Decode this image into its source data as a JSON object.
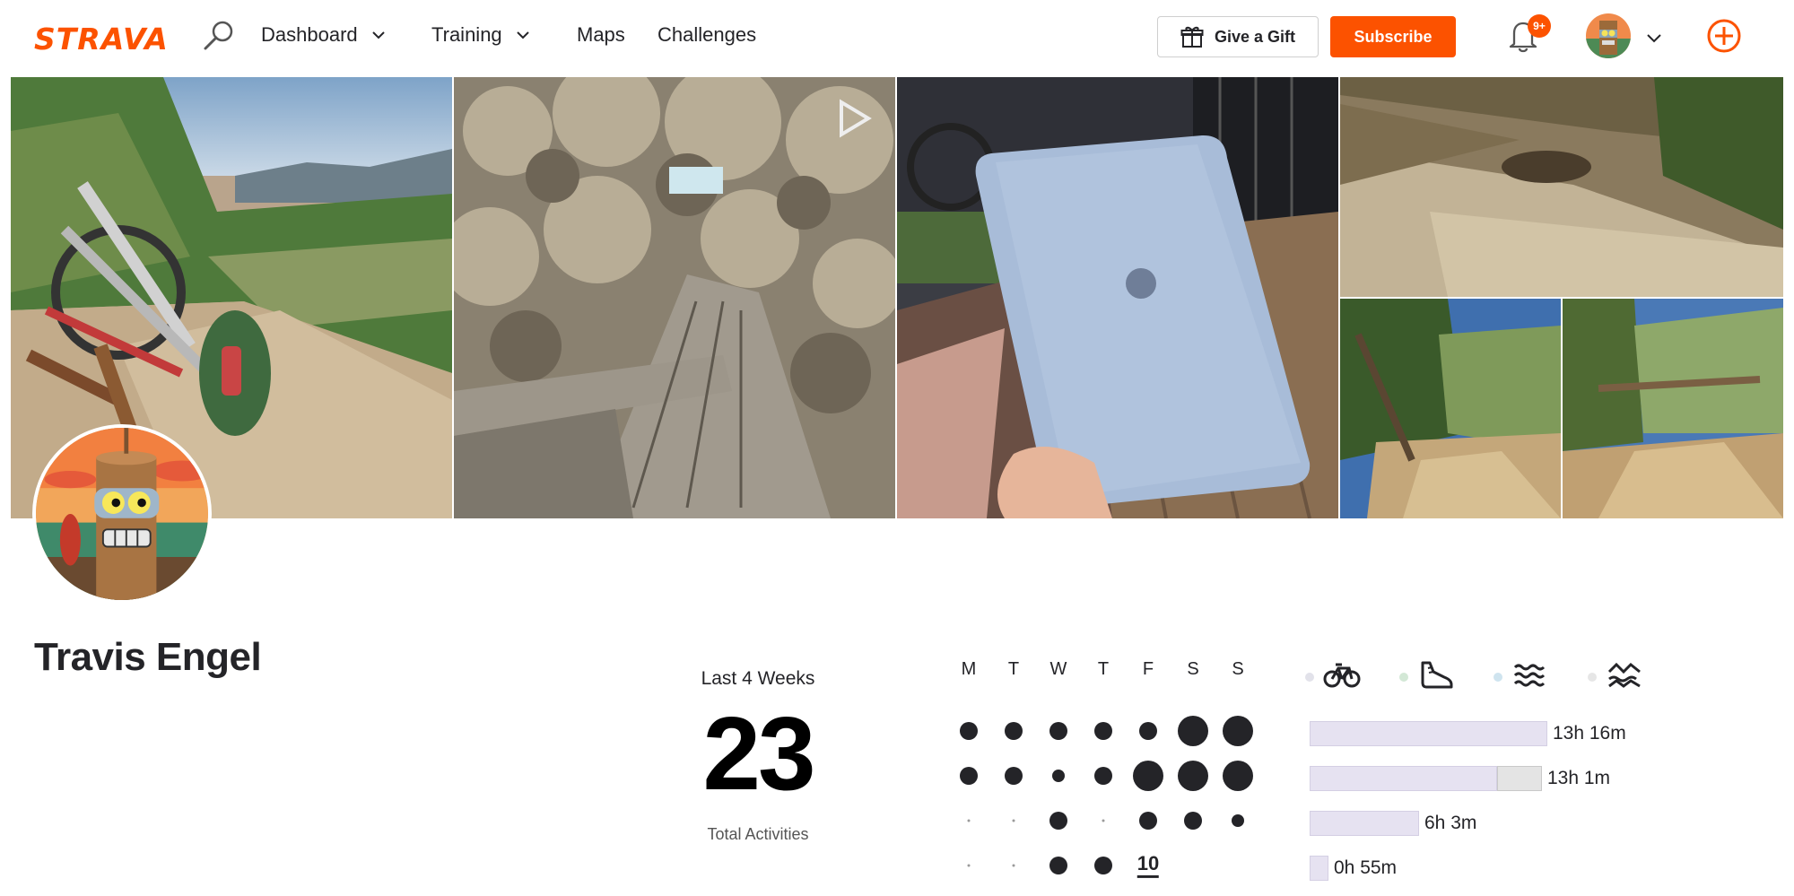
{
  "nav": {
    "logo": "STRAVA",
    "items": [
      {
        "label": "Dashboard",
        "has_dropdown": true
      },
      {
        "label": "Training",
        "has_dropdown": true
      },
      {
        "label": "Maps",
        "has_dropdown": false
      },
      {
        "label": "Challenges",
        "has_dropdown": false
      }
    ],
    "gift_label": "Give a Gift",
    "subscribe_label": "Subscribe",
    "notification_badge": "9+",
    "brand_color": "#fc5200"
  },
  "photos": [
    {
      "subject": "bike-on-trail"
    },
    {
      "subject": "fallen-tree-canopy"
    },
    {
      "subject": "laptop-on-porch"
    },
    {
      "subject": "trail-with-debris"
    },
    {
      "subject": "trail-fallen-trees-left"
    },
    {
      "subject": "trail-fallen-trees-right"
    }
  ],
  "athlete": {
    "name": "Travis Engel"
  },
  "stats": {
    "period_label": "Last 4 Weeks",
    "total": "23",
    "total_label": "Total Activities",
    "days": [
      "M",
      "T",
      "W",
      "T",
      "F",
      "S",
      "S"
    ],
    "today_label": "10",
    "weeks": [
      [
        2,
        2,
        2,
        2,
        2,
        3,
        3
      ],
      [
        2,
        2,
        1,
        2,
        3,
        3,
        3
      ],
      [
        0,
        0,
        2,
        0,
        2,
        2,
        1
      ],
      [
        0,
        0,
        2,
        2,
        "today",
        null,
        null
      ]
    ]
  },
  "sports": [
    {
      "icon": "bike-icon",
      "dot_color": "#e2e2ea"
    },
    {
      "icon": "run-shoe-icon",
      "dot_color": "#d3e8d6"
    },
    {
      "icon": "swim-icon",
      "dot_color": "#cfe4ef"
    },
    {
      "icon": "other-activity-icon",
      "dot_color": "#e6e6e6"
    }
  ],
  "time_bars": [
    {
      "value": "13h 16m",
      "fraction": 1.0,
      "extra_fraction": 0
    },
    {
      "value": "13h 1m",
      "fraction": 0.79,
      "extra_fraction": 0.19
    },
    {
      "value": "6h 3m",
      "fraction": 0.46,
      "extra_fraction": 0
    },
    {
      "value": "0h 55m",
      "fraction": 0.08,
      "extra_fraction": 0
    }
  ]
}
